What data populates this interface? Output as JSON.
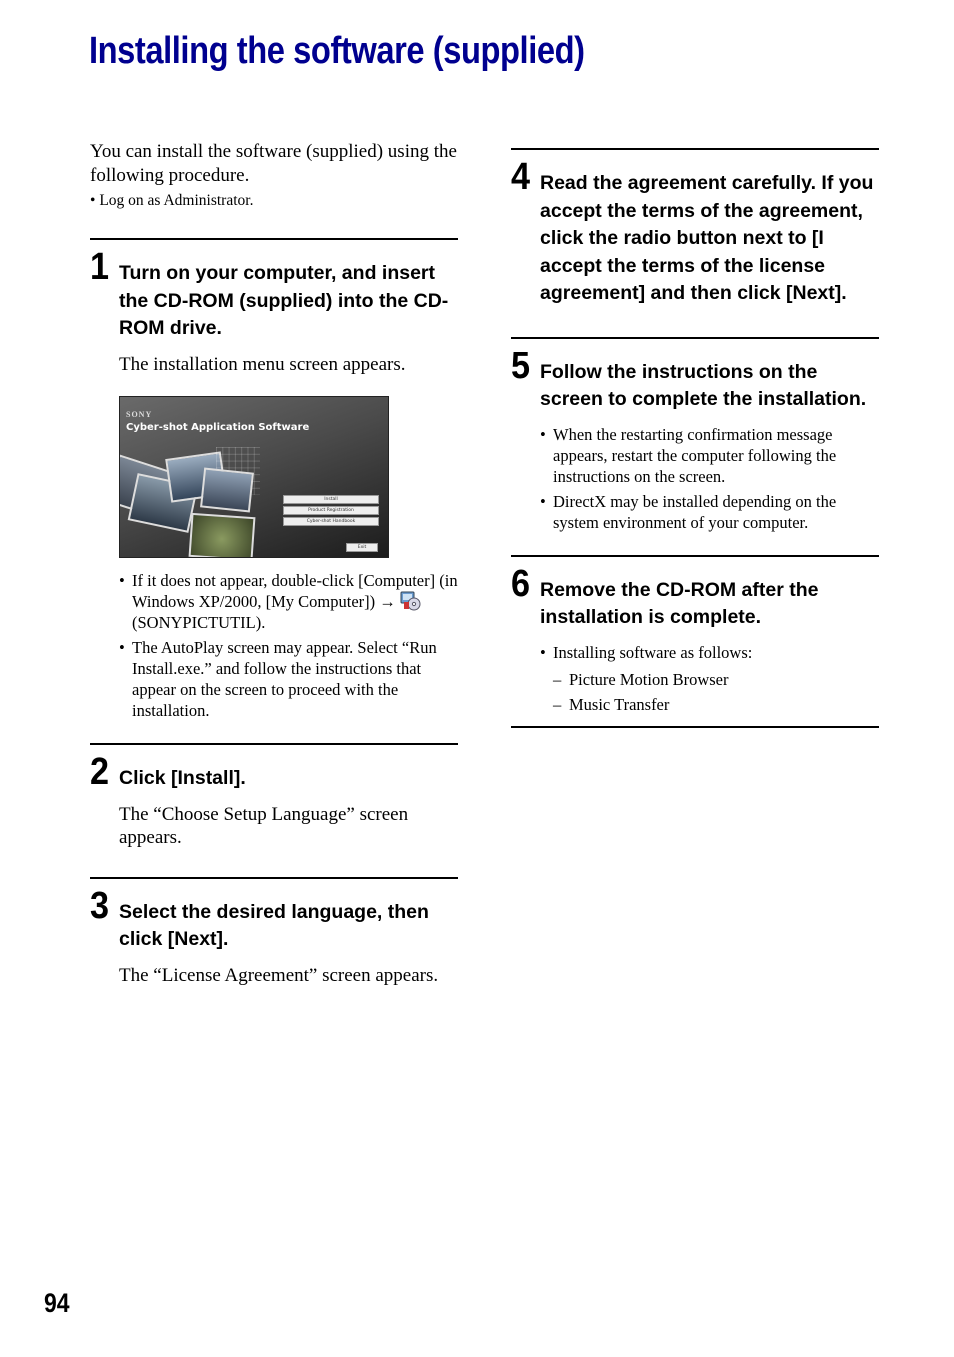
{
  "page": {
    "title": "Installing the software (supplied)",
    "page_number": "94",
    "title_color": "#00008f"
  },
  "intro": {
    "text": "You can install the software (supplied) using the following procedure.",
    "bullet": "Log on as Administrator."
  },
  "steps": [
    {
      "number": "1",
      "title": "Turn on your computer, and insert the CD-ROM (supplied) into the CD-ROM drive.",
      "body": "The installation menu screen appears.",
      "screenshot": {
        "brand": "SONY",
        "title": "Cyber-shot Application Software",
        "buttons": [
          "Install",
          "Product Registration",
          "Cyber-shot Handbook"
        ],
        "exit_button": "Exit"
      },
      "bullets": [
        {
          "before_icon": "If it does not appear, double-click [Computer] (in Windows XP/2000, [My Computer]) → ",
          "icon": "sonypictutil-cd-icon",
          "after_icon": " (SONYPICTUTIL)."
        },
        {
          "text": "The AutoPlay screen may appear. Select “Run Install.exe.” and follow the instructions that appear on the screen to proceed with the installation."
        }
      ]
    },
    {
      "number": "2",
      "title": "Click [Install].",
      "body": "The “Choose Setup Language” screen appears."
    },
    {
      "number": "3",
      "title": "Select the desired language, then click [Next].",
      "body": "The “License Agreement” screen appears."
    },
    {
      "number": "4",
      "title": "Read the agreement carefully. If you accept the terms of the agreement, click the radio button next to [I accept the terms of the license agreement] and then click [Next]."
    },
    {
      "number": "5",
      "title": "Follow the instructions on the screen to complete the installation.",
      "bullets": [
        "When the restarting confirmation message appears, restart the computer following the instructions on the screen.",
        "DirectX may be installed depending on the system environment of your computer."
      ]
    },
    {
      "number": "6",
      "title": "Remove the CD-ROM after the installation is complete.",
      "bullets": [
        "Installing software as follows:"
      ],
      "sub_items": [
        "Picture Motion Browser",
        "Music Transfer"
      ]
    }
  ]
}
